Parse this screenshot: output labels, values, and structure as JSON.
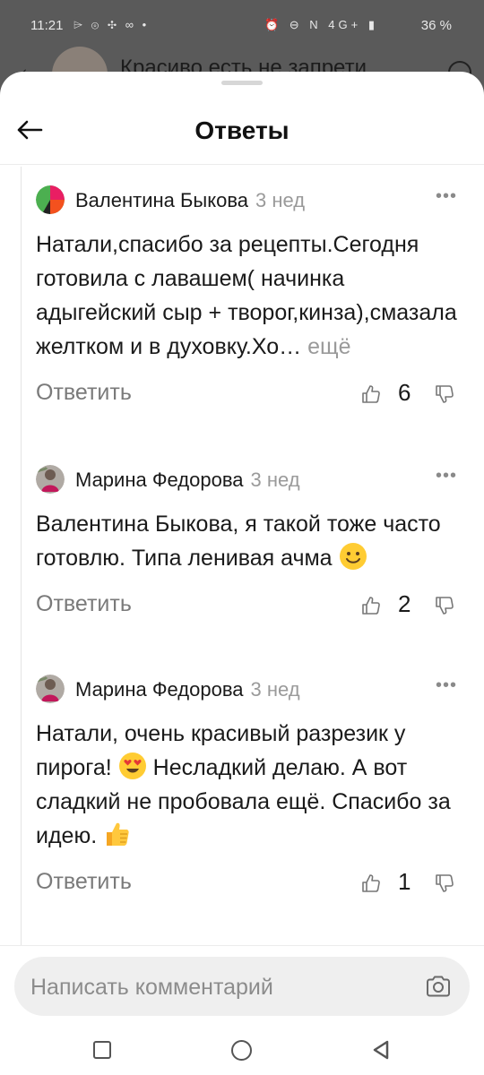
{
  "status_bar": {
    "time": "11:21",
    "left_icons": "⌲ ⊚ ✣ ∞ •",
    "right_icons": "⏰ ⊖ N 4G+ ▮",
    "battery": "36 %"
  },
  "background": {
    "title": "Красиво есть не запрети"
  },
  "header": {
    "title": "Ответы"
  },
  "comments": [
    {
      "author": "Валентина Быкова",
      "date": "3 нед",
      "text": "Натали,спасибо за рецепты.Сегодня готовила с лавашем( начинка адыгейский сыр + творог,кинза),смазала желтком и в духовку.Хо…",
      "more_label": "ещё",
      "reply_label": "Ответить",
      "likes": "6",
      "avatar_colors": [
        "#4caf50",
        "#f4511e",
        "#e91e63",
        "#212121"
      ]
    },
    {
      "author": "Марина Федорова",
      "date": "3 нед",
      "text": "Валентина Быкова, я такой тоже часто готовлю. Типа ленивая ачма",
      "emoji": "slightly-smiling-face",
      "reply_label": "Ответить",
      "likes": "2",
      "avatar_colors": [
        "#9e9e9e",
        "#7b6c5f"
      ]
    },
    {
      "author": "Марина Федорова",
      "date": "3 нед",
      "text_part1": "Натали, очень красивый разрезик у пирога!",
      "emoji1": "heart-eyes-face",
      "text_part2": "Несладкий делаю. А вот сладкий не пробовала ещё. Спасибо за идею.",
      "emoji2": "thumbs-up",
      "reply_label": "Ответить",
      "likes": "1",
      "avatar_colors": [
        "#9e9e9e",
        "#7b6c5f"
      ]
    }
  ],
  "composer": {
    "placeholder": "Написать комментарий"
  }
}
